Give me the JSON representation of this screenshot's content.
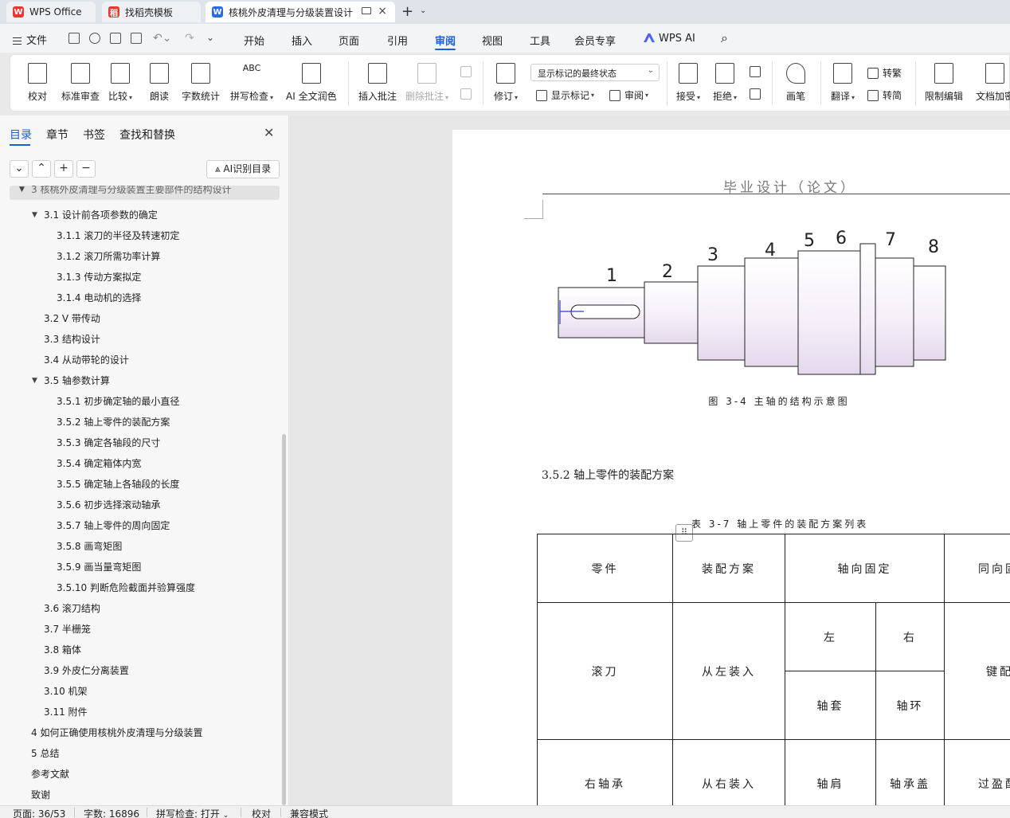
{
  "tabs": [
    {
      "label": "WPS Office",
      "logo": "W"
    },
    {
      "label": "找稻壳模板",
      "logo": "稻"
    },
    {
      "label": "核桃外皮清理与分级装置设计",
      "logo": "W"
    }
  ],
  "colors": {
    "accent": "#1a5fd6",
    "wps_red": "#e8382f",
    "doc_blue": "#2b6be2"
  },
  "menu": {
    "file": "文件",
    "items": [
      "开始",
      "插入",
      "页面",
      "引用",
      "审阅",
      "视图",
      "工具",
      "会员专享"
    ],
    "active": "审阅",
    "ai": "WPS AI"
  },
  "ribbon": {
    "proofread": "校对",
    "standard_review": "标准审查",
    "compare": "比较",
    "read_aloud": "朗读",
    "word_count": "字数统计",
    "spell_check": "拼写检查",
    "ai_polish": "AI 全文润色",
    "insert_comment": "插入批注",
    "delete_comment": "删除批注",
    "track_changes": "修订",
    "markup_state": "显示标记的最终状态",
    "show_markup": "显示标记",
    "review": "审阅",
    "accept": "接受",
    "reject": "拒绝",
    "pen": "画笔",
    "translate": "翻译",
    "to_traditional": "转繁",
    "to_simplified": "转简",
    "restrict_edit": "限制编辑",
    "doc_encrypt": "文档加密",
    "abc": "ABC"
  },
  "sidebar": {
    "tabs": [
      "目录",
      "章节",
      "书签",
      "查找和替换"
    ],
    "ai_toc": "AI识别目录",
    "toc": [
      {
        "text": "3   核桃外皮清理与分级装置主要部件的结构设计",
        "level": 0,
        "expanded": true
      },
      {
        "text": "3.1 设计前各项参数的确定",
        "level": 1,
        "expanded": true
      },
      {
        "text": "3.1.1  滚刀的半径及转速初定",
        "level": 2
      },
      {
        "text": "3.1.2  滚刀所需功率计算",
        "level": 2
      },
      {
        "text": "3.1.3  传动方案拟定",
        "level": 2
      },
      {
        "text": "3.1.4  电动机的选择",
        "level": 2
      },
      {
        "text": "3.2 V 带传动",
        "level": 1
      },
      {
        "text": "3.3  结构设计",
        "level": 1
      },
      {
        "text": "3.4  从动带轮的设计",
        "level": 1
      },
      {
        "text": "3.5  轴参数计算",
        "level": 1,
        "expanded": true
      },
      {
        "text": "3.5.1  初步确定轴的最小直径",
        "level": 2
      },
      {
        "text": "3.5.2  轴上零件的装配方案",
        "level": 2
      },
      {
        "text": "3.5.3  确定各轴段的尺寸",
        "level": 2
      },
      {
        "text": "3.5.4  确定箱体内宽",
        "level": 2
      },
      {
        "text": "3.5.5  确定轴上各轴段的长度",
        "level": 2
      },
      {
        "text": "3.5.6  初步选择滚动轴承",
        "level": 2
      },
      {
        "text": "3.5.7  轴上零件的周向固定",
        "level": 2
      },
      {
        "text": "3.5.8  画弯矩图",
        "level": 2
      },
      {
        "text": "3.5.9  画当量弯矩图",
        "level": 2
      },
      {
        "text": "3.5.10  判断危险截面并验算强度",
        "level": 2
      },
      {
        "text": "3.6  滚刀结构",
        "level": 1
      },
      {
        "text": "3.7  半栅笼",
        "level": 1
      },
      {
        "text": "3.8  箱体",
        "level": 1
      },
      {
        "text": "3.9  外皮仁分离装置",
        "level": 1
      },
      {
        "text": "3.10  机架",
        "level": 1
      },
      {
        "text": "3.11  附件",
        "level": 1
      },
      {
        "text": "4   如何正确使用核桃外皮清理与分级装置",
        "level": 0
      },
      {
        "text": "5   总结",
        "level": 0
      },
      {
        "text": "参考文献",
        "level": 0
      },
      {
        "text": "致谢",
        "level": 0
      }
    ]
  },
  "document": {
    "header": "毕业设计（论文）",
    "figure_numbers": [
      "1",
      "2",
      "3",
      "4",
      "5",
      "6",
      "7",
      "8"
    ],
    "figure_caption": "图 3-4 主轴的结构示意图",
    "section_title": "3.5.2  轴上零件的装配方案",
    "table_caption": "表 3-7   轴上零件的装配方案列表",
    "table": {
      "h_part": "零件",
      "h_scheme": "装配方案",
      "h_axial": "轴向固定",
      "h_circ": "同向固",
      "left": "左",
      "right": "右",
      "r1_part": "滚刀",
      "r1_scheme": "从左装入",
      "r1_left": "轴套",
      "r1_right": "轴环",
      "r1_circ": "键配",
      "r2_part": "右轴承",
      "r2_scheme": "从右装入",
      "r2_left": "轴肩",
      "r2_right": "轴承盖",
      "r2_circ": "过盈配"
    }
  },
  "status": {
    "page": "页面: 36/53",
    "words": "字数: 16896",
    "spell": "拼写检查: 打开",
    "proof": "校对",
    "compat": "兼容模式"
  }
}
